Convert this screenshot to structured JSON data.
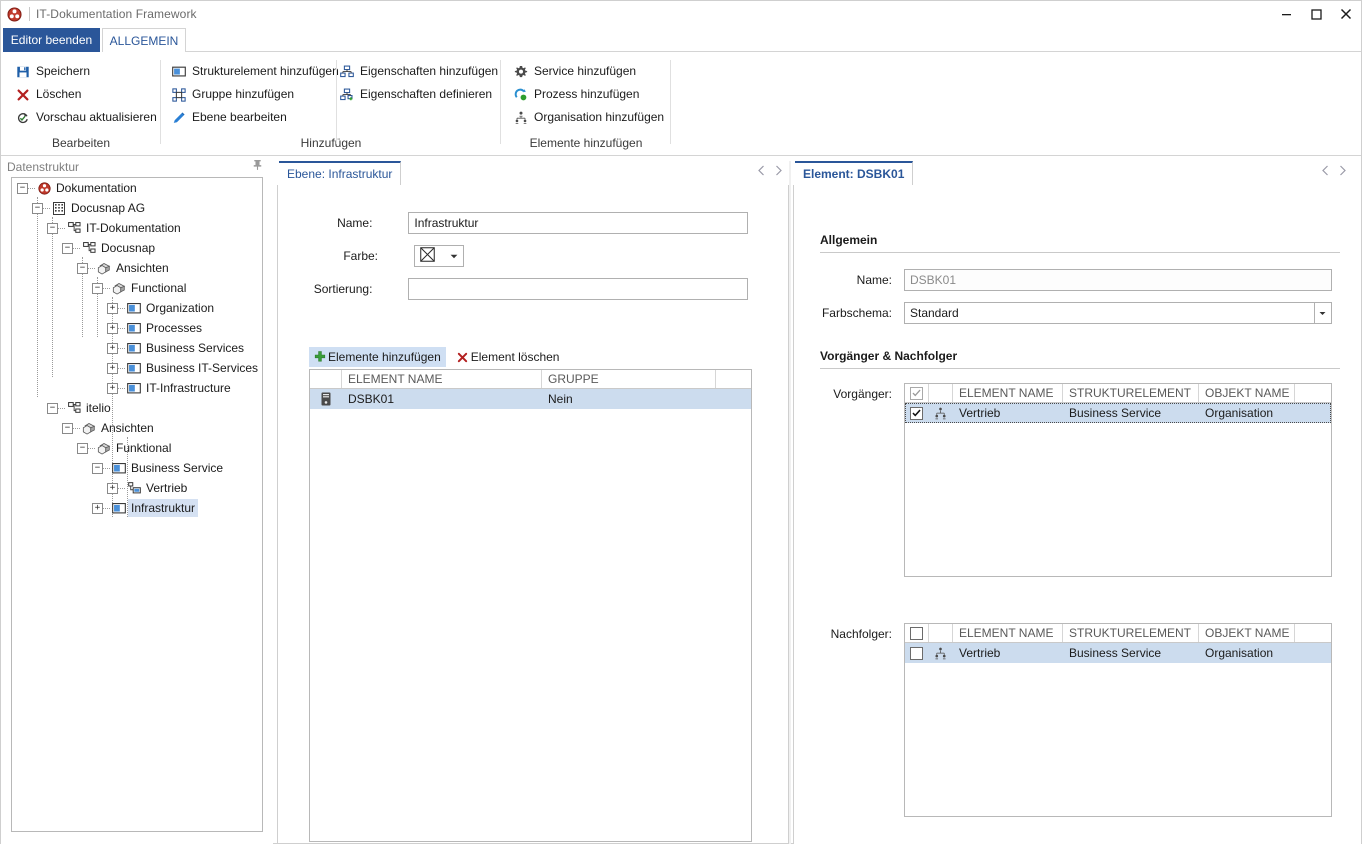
{
  "window": {
    "title": "IT-Dokumentation Framework",
    "logo_icon": "docusnap-logo-icon",
    "controls": {
      "minimize": "minimize-icon",
      "maximize": "maximize-icon",
      "close": "close-icon"
    }
  },
  "ribbon": {
    "tabs": [
      {
        "id": "exit",
        "label": "Editor beenden",
        "active": false,
        "style": "accent"
      },
      {
        "id": "general",
        "label": "ALLGEMEIN",
        "active": true,
        "style": "tab"
      }
    ],
    "groups": [
      {
        "id": "bearbeiten",
        "label": "Bearbeiten",
        "items": [
          {
            "label": "Speichern",
            "icon": "save-icon"
          },
          {
            "label": "Löschen",
            "icon": "delete-x-icon"
          },
          {
            "label": "Vorschau aktualisieren",
            "icon": "refresh-preview-icon"
          }
        ]
      },
      {
        "id": "hinzufuegen",
        "label": "Hinzufügen",
        "col1": [
          {
            "label": "Strukturelement hinzufügen",
            "icon": "structure-element-icon"
          },
          {
            "label": "Gruppe hinzufügen",
            "icon": "group-icon"
          },
          {
            "label": "Ebene bearbeiten",
            "icon": "edit-pencil-icon"
          }
        ],
        "col2": [
          {
            "label": "Eigenschaften hinzufügen",
            "icon": "properties-add-icon"
          },
          {
            "label": "Eigenschaften definieren",
            "icon": "properties-define-icon"
          }
        ]
      },
      {
        "id": "elemente",
        "label": "Elemente hinzufügen",
        "items": [
          {
            "label": "Service hinzufügen",
            "icon": "gear-icon"
          },
          {
            "label": "Prozess hinzufügen",
            "icon": "process-icon"
          },
          {
            "label": "Organisation hinzufügen",
            "icon": "organisation-icon"
          }
        ]
      }
    ]
  },
  "left_panel": {
    "title": "Datenstruktur",
    "pin_icon": "pin-icon",
    "tree": [
      {
        "depth": 0,
        "label": "Dokumentation",
        "icon": "docusnap-logo-icon",
        "expander": "minus",
        "selected": false
      },
      {
        "depth": 1,
        "label": "Docusnap AG",
        "icon": "company-icon",
        "expander": "minus",
        "selected": false
      },
      {
        "depth": 2,
        "label": "IT-Dokumentation",
        "icon": "sitemap-icon",
        "expander": "minus",
        "selected": false
      },
      {
        "depth": 3,
        "label": "Docusnap",
        "icon": "sitemap-icon",
        "expander": "minus",
        "selected": false
      },
      {
        "depth": 4,
        "label": "Ansichten",
        "icon": "cube-icon",
        "expander": "minus",
        "selected": false
      },
      {
        "depth": 5,
        "label": "Functional",
        "icon": "cube-icon",
        "expander": "minus",
        "selected": false
      },
      {
        "depth": 6,
        "label": "Organization",
        "icon": "layer-icon",
        "expander": "plus",
        "selected": false
      },
      {
        "depth": 6,
        "label": "Processes",
        "icon": "layer-icon",
        "expander": "plus",
        "selected": false
      },
      {
        "depth": 6,
        "label": "Business Services",
        "icon": "layer-icon",
        "expander": "plus",
        "selected": false
      },
      {
        "depth": 6,
        "label": "Business IT-Services",
        "icon": "layer-icon",
        "expander": "plus",
        "selected": false
      },
      {
        "depth": 6,
        "label": "IT-Infrastructure",
        "icon": "layer-icon",
        "expander": "plus",
        "selected": false
      },
      {
        "depth": 2,
        "label": "itelio",
        "icon": "sitemap-icon",
        "expander": "minus",
        "selected": false
      },
      {
        "depth": 3,
        "label": "Ansichten",
        "icon": "cube-icon",
        "expander": "minus",
        "selected": false
      },
      {
        "depth": 4,
        "label": "Funktional",
        "icon": "cube-icon",
        "expander": "minus",
        "selected": false
      },
      {
        "depth": 5,
        "label": "Business Service",
        "icon": "layer-icon",
        "expander": "minus",
        "selected": false
      },
      {
        "depth": 6,
        "label": "Vertrieb",
        "icon": "element-node-icon",
        "expander": "plus",
        "selected": false
      },
      {
        "depth": 5,
        "label": "Infrastruktur",
        "icon": "layer-icon",
        "expander": "plus",
        "selected": true
      }
    ]
  },
  "center_panel": {
    "tab_label": "Ebene: Infrastruktur",
    "nav_prev_icon": "nav-prev-icon",
    "nav_next_icon": "nav-next-icon",
    "fields": {
      "name_label": "Name:",
      "name_value": "Infrastruktur",
      "farbe_label": "Farbe:",
      "farbe_value": "",
      "farbe_swatch": "no-color-swatch-icon",
      "sortierung_label": "Sortierung:",
      "sortierung_value": ""
    },
    "toolbar": {
      "add_label": "Elemente hinzufügen",
      "add_icon": "plus-green-icon",
      "delete_label": "Element löschen",
      "delete_icon": "delete-x-icon"
    },
    "grid": {
      "columns": [
        "",
        "ELEMENT NAME",
        "GRUPPE",
        ""
      ],
      "rows": [
        {
          "icon": "server-icon",
          "element_name": "DSBK01",
          "gruppe": "Nein",
          "selected": true
        }
      ]
    }
  },
  "right_panel": {
    "tab_label": "Element: DSBK01",
    "nav_prev_icon": "nav-prev-icon",
    "nav_next_icon": "nav-next-icon",
    "sections": {
      "allgemein": "Allgemein",
      "vorgaenger_nachfolger": "Vorgänger & Nachfolger"
    },
    "fields": {
      "name_label": "Name:",
      "name_value": "DSBK01",
      "farbschema_label": "Farbschema:",
      "farbschema_value": "Standard",
      "farbschema_options": [
        "Standard"
      ]
    },
    "vorgaenger": {
      "label": "Vorgänger:",
      "header_checkbox": "checked-gray",
      "columns": [
        "",
        "",
        "ELEMENT NAME",
        "STRUKTURELEMENT",
        "OBJEKT NAME",
        ""
      ],
      "rows": [
        {
          "checked": true,
          "icon": "organisation-icon",
          "element_name": "Vertrieb",
          "strukturelement": "Business Service",
          "objekt_name": "Organisation",
          "selected": true
        }
      ]
    },
    "nachfolger": {
      "label": "Nachfolger:",
      "header_checkbox": "unchecked",
      "columns": [
        "",
        "",
        "ELEMENT NAME",
        "STRUKTURELEMENT",
        "OBJEKT NAME",
        ""
      ],
      "rows": [
        {
          "checked": false,
          "icon": "organisation-icon",
          "element_name": "Vertrieb",
          "strukturelement": "Business Service",
          "objekt_name": "Organisation",
          "selected": true
        }
      ]
    }
  },
  "colors": {
    "accent": "#2a5699",
    "selection": "#ccdcee",
    "tree_selection": "#d5e1f2",
    "grid_header_text": "#5a5a5a",
    "green": "#3a9e3a",
    "red": "#b32020"
  }
}
